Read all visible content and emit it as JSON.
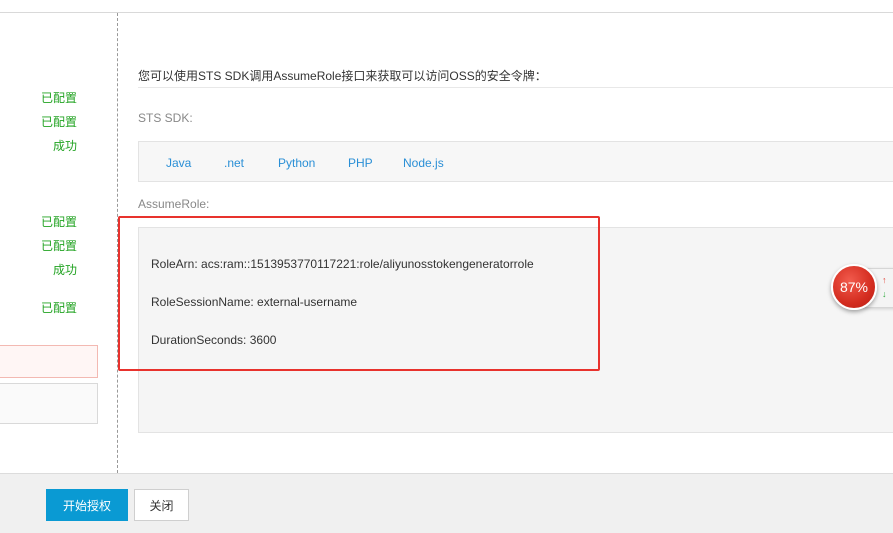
{
  "left_statuses": [
    "已配置",
    "已配置",
    "成功",
    "已配置",
    "已配置",
    "成功",
    "已配置"
  ],
  "main": {
    "intro": "您可以使用STS SDK调用AssumeRole接口来获取可以访问OSS的安全令牌：",
    "sts_sdk_label": "STS SDK:",
    "sdk_links": [
      "Java",
      ".net",
      "Python",
      "PHP",
      "Node.js"
    ],
    "assume_role_label": "AssumeRole:",
    "assume_role_lines": [
      "RoleArn: acs:ram::1513953770117221:role/aliyunosstokengeneratorrole",
      "RoleSessionName: external-username",
      "DurationSeconds: 3600"
    ]
  },
  "widget": {
    "percent": "87%",
    "up_arrow": "↑",
    "down_arrow": "↓"
  },
  "footer": {
    "start_button": "开始授权",
    "close_button": "关闭"
  },
  "colors": {
    "primary": "#0a9ad3",
    "success": "#22a322",
    "highlight": "#e8322d",
    "link": "#2a8fd6"
  }
}
